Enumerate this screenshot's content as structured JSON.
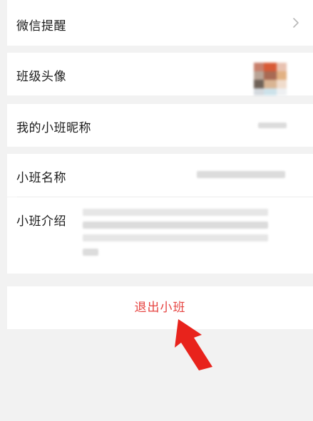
{
  "rows": {
    "wechat_reminder": {
      "label": "微信提醒"
    },
    "class_avatar": {
      "label": "班级头像"
    },
    "my_nickname": {
      "label": "我的小班昵称"
    },
    "class_name": {
      "label": "小班名称"
    },
    "class_intro": {
      "label": "小班介绍"
    }
  },
  "exit_button": {
    "label": "退出小班"
  },
  "colors": {
    "exit_text": "#e64340",
    "annotation_arrow": "#e8231c",
    "background": "#f2f2f2"
  },
  "icons": {
    "chevron": "chevron-right-icon",
    "arrow": "red-pointer-arrow"
  }
}
